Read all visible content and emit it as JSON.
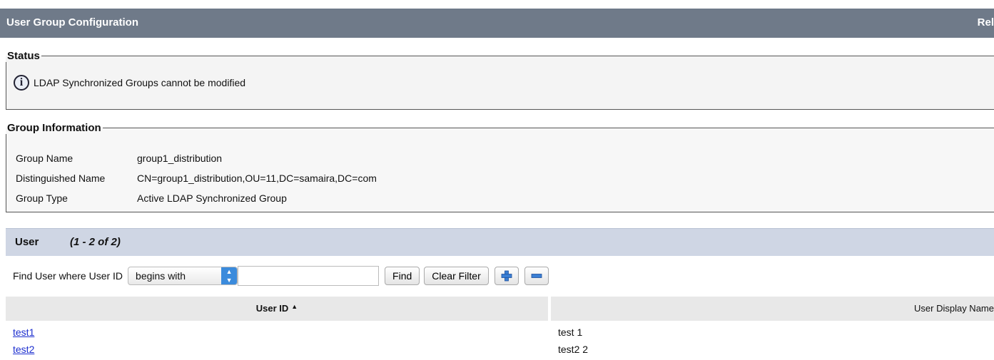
{
  "header": {
    "title": "User Group Configuration",
    "right_label": "Rel"
  },
  "status": {
    "legend": "Status",
    "message": "LDAP Synchronized Groups cannot be modified"
  },
  "group_info": {
    "legend": "Group Information",
    "fields": [
      {
        "label": "Group Name",
        "value": "group1_distribution"
      },
      {
        "label": "Distinguished Name",
        "value": "CN=group1_distribution,OU=11,DC=samaira,DC=com"
      },
      {
        "label": "Group Type",
        "value": "Active LDAP Synchronized Group"
      }
    ]
  },
  "user_section": {
    "title": "User",
    "count": "(1 - 2 of 2)"
  },
  "filter": {
    "label": "Find User where User ID",
    "operator": "begins with",
    "query": "",
    "find_label": "Find",
    "clear_label": "Clear Filter"
  },
  "table": {
    "columns": [
      "User ID",
      "User Display Name"
    ],
    "rows": [
      {
        "user_id": "test1",
        "display_name": "test 1"
      },
      {
        "user_id": "test2",
        "display_name": "test2 2"
      }
    ]
  },
  "colors": {
    "title_bar": "#6f7a89",
    "section_bar": "#cfd6e4",
    "link": "#1d2fcf",
    "accent": "#3b8bdc"
  }
}
